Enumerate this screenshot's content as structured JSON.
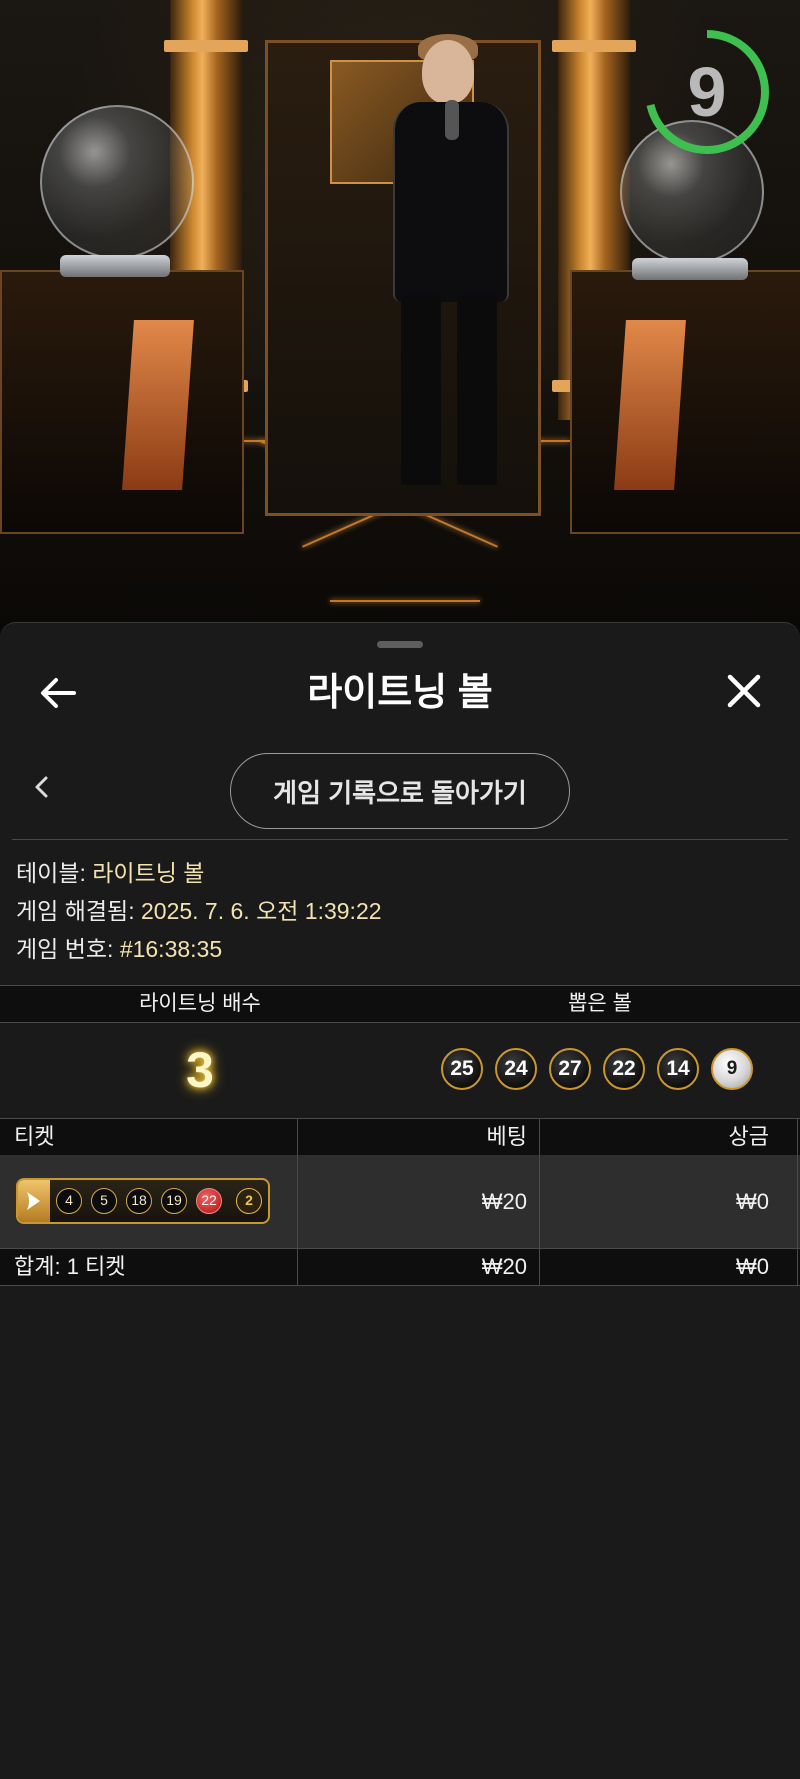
{
  "timer": {
    "value": "9",
    "color": "#3fbf4f"
  },
  "sheet": {
    "title": "라이트닝 볼",
    "history_button": "게임 기록으로 돌아가기",
    "info": {
      "table_label": "테이블:",
      "table_value": "라이트닝 볼",
      "resolved_label": "게임 해결됨:",
      "resolved_value": "2025. 7. 6. 오전 1:39:22",
      "game_no_label": "게임 번호:",
      "game_no_value": "#16:38:35"
    },
    "results": {
      "multiplier_header": "라이트닝 배수",
      "balls_header": "뽑은 볼",
      "multiplier": "3",
      "drawn_balls": [
        "25",
        "24",
        "27",
        "22",
        "14",
        "9"
      ]
    },
    "tickets": {
      "headers": {
        "ticket": "티켓",
        "bet": "베팅",
        "payout": "상금"
      },
      "rows": [
        {
          "numbers": [
            "4",
            "5",
            "18",
            "19",
            "22"
          ],
          "bonus": "2",
          "bet": "₩20",
          "payout": "₩0"
        }
      ],
      "total": {
        "label": "합계: 1 티켓",
        "bet": "₩20",
        "payout": "₩0"
      }
    }
  }
}
